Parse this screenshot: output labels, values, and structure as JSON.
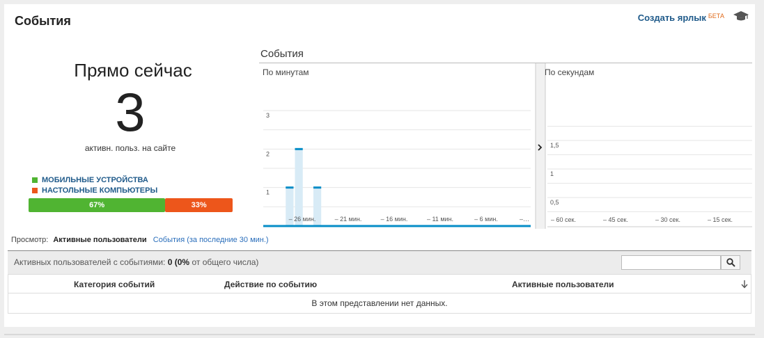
{
  "page": {
    "title": "События"
  },
  "header": {
    "shortcut_label": "Создать ярлык",
    "beta_label": "БЕТА",
    "icon": "graduation-cap-icon"
  },
  "realtime": {
    "label": "Прямо сейчас",
    "active_users": "3",
    "sublabel": "активн. польз. на сайте",
    "legend": [
      {
        "label": "МОБИЛЬНЫЕ УСТРОЙСТВА",
        "color": "#50b432"
      },
      {
        "label": "НАСТОЛЬНЫЕ КОМПЬЮТЕРЫ",
        "color": "#ed561b"
      }
    ],
    "split": [
      {
        "label": "67%",
        "value": 67,
        "color": "#50b432"
      },
      {
        "label": "33%",
        "value": 33,
        "color": "#ed561b"
      }
    ]
  },
  "chart_data": [
    {
      "type": "bar",
      "title": "События",
      "panel_label": "По минутам",
      "y_ticks": [
        "1",
        "2",
        "3"
      ],
      "ylim": [
        0,
        3
      ],
      "x_tick_labels": [
        "– 26 мин.",
        "– 21 мин.",
        "– 16 мин.",
        "– 11 мин.",
        "– 6 мин.",
        "–…"
      ],
      "x": [
        -30,
        -29,
        -28,
        -27,
        -26,
        -25,
        -24,
        -23,
        -22,
        -21,
        -20,
        -19,
        -18,
        -17,
        -16,
        -15,
        -14,
        -13,
        -12,
        -11,
        -10,
        -9,
        -8,
        -7,
        -6,
        -5,
        -4,
        -3,
        -2,
        -1
      ],
      "values": [
        0,
        1,
        2,
        0,
        1,
        0,
        0,
        0,
        0,
        0,
        0,
        0,
        0,
        0,
        0,
        0,
        0,
        0,
        0,
        0,
        0,
        0,
        0,
        0,
        0,
        0,
        0,
        0,
        0,
        0
      ],
      "color": "#058dc7"
    },
    {
      "type": "bar",
      "panel_label": "По секундам",
      "y_ticks": [
        "0,5",
        "1",
        "1,5"
      ],
      "ylim": [
        0,
        2
      ],
      "x_tick_labels": [
        "– 60 сек.",
        "– 45 сек.",
        "– 30 сек.",
        "– 15 сек."
      ],
      "values": [],
      "color": "#058dc7"
    }
  ],
  "view": {
    "label": "Просмотр:",
    "active_tab": "Активные пользователи",
    "other_tab": "События (за последние 30 мин.)"
  },
  "table": {
    "summary_prefix": "Активных пользователей с событиями:",
    "summary_count": "0",
    "summary_suffix_bold": "(0%",
    "summary_suffix": "от общего числа)",
    "search_placeholder": "",
    "columns": [
      "Категория событий",
      "Действие по событию",
      "Активные пользователи"
    ],
    "empty_message": "В этом представлении нет данных."
  }
}
